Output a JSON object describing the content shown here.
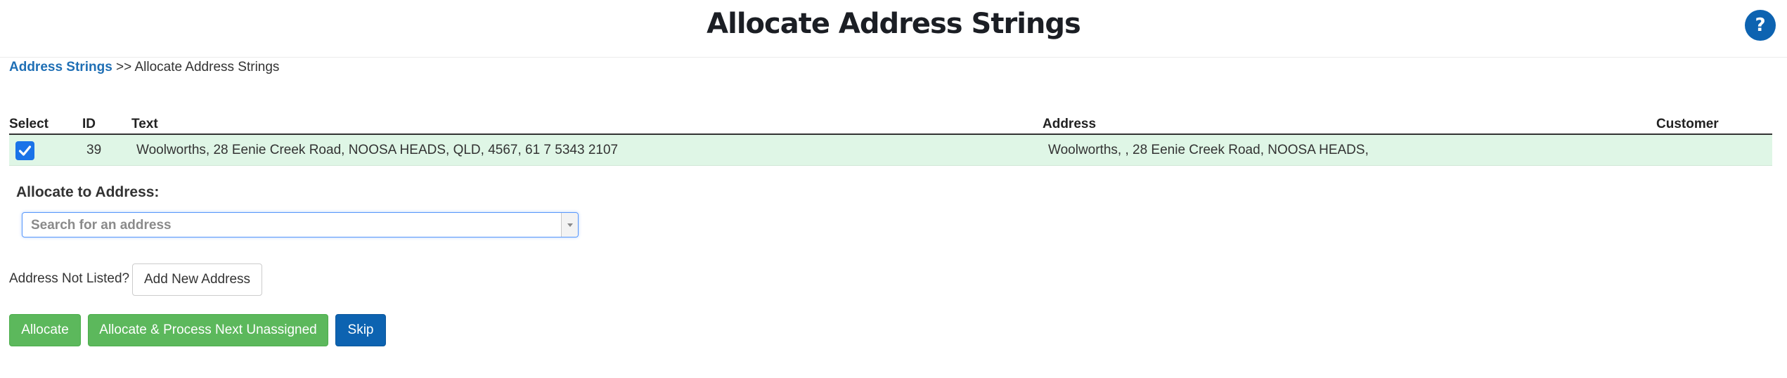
{
  "header": {
    "title": "Allocate Address Strings",
    "help_label": "?"
  },
  "breadcrumb": {
    "link_label": "Address Strings",
    "separator": ">>",
    "current": "Allocate Address Strings"
  },
  "table": {
    "columns": [
      "Select",
      "ID",
      "Text",
      "Address",
      "Customer"
    ],
    "rows": [
      {
        "selected": true,
        "id": "39",
        "text": "Woolworths, 28 Eenie Creek Road, NOOSA HEADS, QLD, 4567, 61 7 5343 2107",
        "address": "Woolworths, , 28 Eenie Creek Road, NOOSA HEADS,",
        "customer": ""
      }
    ]
  },
  "allocate": {
    "label": "Allocate to Address:",
    "search_placeholder": "Search for an address"
  },
  "not_listed": {
    "label": "Address Not Listed?",
    "add_button_label": "Add New Address"
  },
  "actions": {
    "allocate_label": "Allocate",
    "allocate_next_label": "Allocate & Process Next Unassigned",
    "skip_label": "Skip"
  },
  "colors": {
    "primary_blue": "#0d63b1",
    "success_green": "#5cb85c",
    "row_highlight": "#dff6e6",
    "link_blue": "#1f6fb5"
  },
  "icons": {
    "help": "question-mark-icon",
    "checkbox": "checkmark-icon",
    "dropdown": "chevron-down-icon"
  }
}
